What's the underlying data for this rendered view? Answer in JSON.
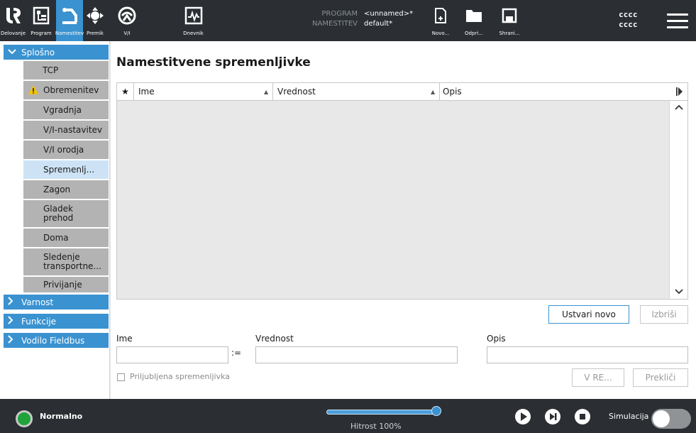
{
  "topbar": {
    "tabs": [
      {
        "label": "Delovanje",
        "icon": "ur-logo-icon"
      },
      {
        "label": "Program",
        "icon": "program-tree-icon"
      },
      {
        "label": "Namestitev",
        "icon": "installation-robot-icon"
      },
      {
        "label": "Premik",
        "icon": "move-arrows-icon"
      },
      {
        "label": "V/I",
        "icon": "io-icon"
      },
      {
        "label": "Dnevnik",
        "icon": "log-icon"
      }
    ],
    "program_label": "PROGRAM",
    "program_value": "<unnamed>*",
    "installation_label": "NAMESTITEV",
    "installation_value": "default*",
    "file_buttons": [
      {
        "label": "Novo...",
        "icon": "new-file-icon"
      },
      {
        "label": "Odpri...",
        "icon": "open-folder-icon"
      },
      {
        "label": "Shrani...",
        "icon": "save-disk-icon"
      }
    ],
    "user_line1": "cccc",
    "user_line2": "cccc"
  },
  "sidebar": {
    "sections": [
      {
        "label": "Splošno",
        "expanded": true
      },
      {
        "label": "Varnost",
        "expanded": false
      },
      {
        "label": "Funkcije",
        "expanded": false
      },
      {
        "label": "Vodilo Fieldbus",
        "expanded": false
      }
    ],
    "items": [
      {
        "label": "TCP"
      },
      {
        "label": "Obremenitev",
        "warning": true
      },
      {
        "label": "Vgradnja"
      },
      {
        "label": "V/I-nastavitev"
      },
      {
        "label": "V/I orodja"
      },
      {
        "label": "Spremenlj...",
        "selected": true
      },
      {
        "label": "Zagon"
      },
      {
        "label": "Gladek prehod"
      },
      {
        "label": "Doma"
      },
      {
        "label": "Sledenje transportne..."
      },
      {
        "label": "Privijanje"
      }
    ]
  },
  "main": {
    "title": "Namestitvene spremenljivke",
    "columns": [
      "★",
      "Ime",
      "Vrednost",
      "Opis"
    ],
    "rows": [],
    "create_button": "Ustvari novo",
    "delete_button": "Izbriši",
    "name_label": "Ime",
    "value_label": "Vrednost",
    "desc_label": "Opis",
    "name_value": "",
    "value_value": "",
    "desc_value": "",
    "assign_operator": ":=",
    "favorite_label": "Priljubljena spremenljivka",
    "favorite_checked": false,
    "apply_button": "V RE...",
    "cancel_button": "Prekliči"
  },
  "bottombar": {
    "status": "Normalno",
    "status_color": "#1fa33a",
    "speed_label": "Hitrost 100%",
    "speed_fraction": 1.0,
    "simulation_label": "Simulacija",
    "simulation_on": false,
    "accent": "#3a92d0"
  }
}
